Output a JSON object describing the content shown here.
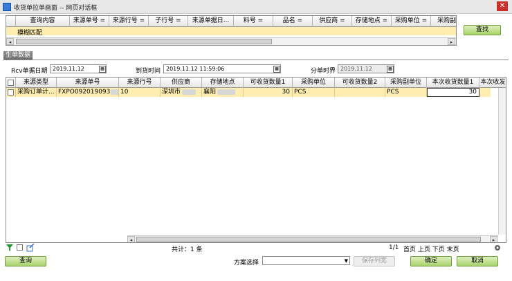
{
  "window": {
    "title": "收货单拉单画面 -- 网页对话框",
    "close_glyph": "✕"
  },
  "conditions": {
    "headers": [
      "查询内容",
      "来源单号 =",
      "来源行号 =",
      "子行号 =",
      "来源单据日...",
      "料号 =",
      "品名 =",
      "供应商 =",
      "存储地点 =",
      "采购单位 =",
      "采购副"
    ],
    "row_value": "模糊匹配",
    "scroll_left": "◂",
    "scroll_right": "▸"
  },
  "buttons": {
    "search": "查找",
    "query": "查询",
    "save_scheme": "保存列宽",
    "ok": "确定",
    "cancel": "取消"
  },
  "section_title": "生单数据",
  "dates": {
    "rcv_label": "Rcv单据日期",
    "rcv_value": "2019.11.12",
    "arrive_label": "到货时间",
    "arrive_value": "2019.11.12 11:59:06",
    "split_label": "分单时界",
    "split_value": "2019.11.12",
    "calendar_glyph": "▦"
  },
  "grid": {
    "headers": [
      "来源类型",
      "来源单号",
      "来源行号",
      "供应商",
      "存储地点",
      "可收货数量1",
      "采购单位",
      "可收货数量2",
      "采购副单位",
      "本次收货数量1",
      "本次收发"
    ],
    "row": {
      "source_type": "采购订单计...",
      "source_no": "FXPO092019093",
      "source_no_suffix": "2",
      "line_no": "10",
      "supplier": "深圳市",
      "location": "襄阳",
      "qty1": "30",
      "unit": "PCS",
      "qty2": "",
      "sub_unit": "PCS",
      "receive_qty": "30"
    }
  },
  "status": {
    "total": "共计：1 条",
    "page_info": "1/1",
    "page_nav": "首页 上页 下页 末页",
    "scroll_left": "◂",
    "scroll_right": "▸"
  },
  "scheme": {
    "label": "方案选择",
    "value": ""
  }
}
